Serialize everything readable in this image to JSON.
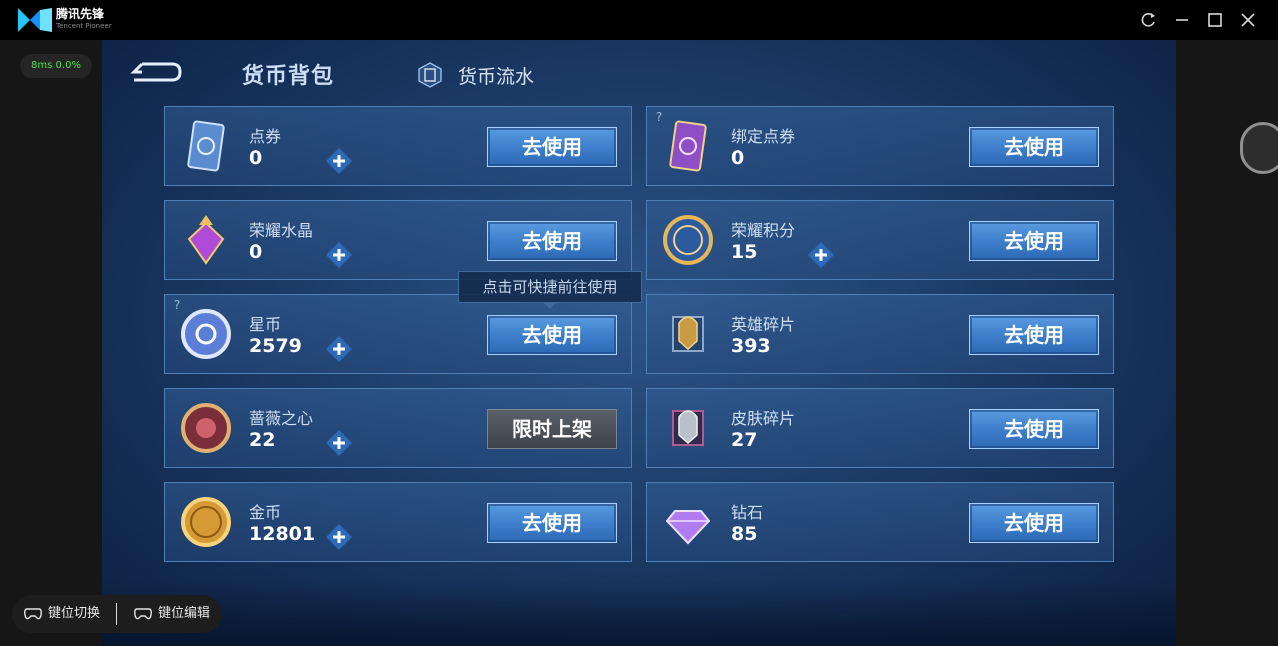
{
  "window": {
    "app_name": "腾讯先锋",
    "app_subtitle": "Tencent Pioneer",
    "controls": [
      "refresh-icon",
      "minimize-icon",
      "maximize-icon",
      "close-icon"
    ]
  },
  "perf": {
    "text": "8ms 0.0%"
  },
  "header": {
    "active_tab": "货币背包",
    "other_tab": "货币流水"
  },
  "currencies": [
    {
      "name": "点券",
      "value": "0",
      "icon": "coupon-card-icon",
      "plus": true,
      "action": "去使用",
      "help": false
    },
    {
      "name": "绑定点券",
      "value": "0",
      "icon": "bound-coupon-card-icon",
      "plus": false,
      "action": "去使用",
      "help": true
    },
    {
      "name": "荣耀水晶",
      "value": "0",
      "icon": "honor-crystal-icon",
      "plus": true,
      "action": "去使用",
      "help": false
    },
    {
      "name": "荣耀积分",
      "value": "15",
      "icon": "honor-points-icon",
      "plus": true,
      "action": "去使用",
      "help": false
    },
    {
      "name": "星币",
      "value": "2579",
      "icon": "star-coin-icon",
      "plus": true,
      "action": "去使用",
      "help": true
    },
    {
      "name": "英雄碎片",
      "value": "393",
      "icon": "hero-fragment-icon",
      "plus": false,
      "action": "去使用",
      "help": false
    },
    {
      "name": "蔷薇之心",
      "value": "22",
      "icon": "rose-heart-icon",
      "plus": true,
      "action": "限时上架",
      "help": false
    },
    {
      "name": "皮肤碎片",
      "value": "27",
      "icon": "skin-fragment-icon",
      "plus": false,
      "action": "去使用",
      "help": false
    },
    {
      "name": "金币",
      "value": "12801",
      "icon": "gold-coin-icon",
      "plus": true,
      "action": "去使用",
      "help": false
    },
    {
      "name": "钻石",
      "value": "85",
      "icon": "diamond-icon",
      "plus": false,
      "action": "去使用",
      "help": false
    }
  ],
  "tooltip": {
    "text": "点击可快捷前往使用"
  },
  "keybar": {
    "switch_label": "键位切换",
    "edit_label": "键位编辑"
  },
  "colors": {
    "button_blue": "#3e7fcb",
    "button_grey": "#4a5058",
    "panel_border": "#4f7fb5",
    "perf_green": "#4de04d"
  }
}
